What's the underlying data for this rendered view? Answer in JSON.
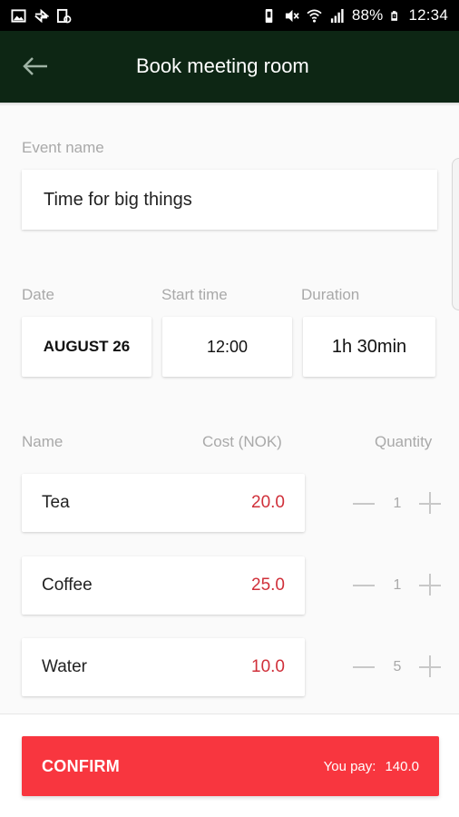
{
  "status_bar": {
    "battery_percent": "88%",
    "time": "12:34",
    "left_icons": [
      "image-icon",
      "sync-icon",
      "device-icon"
    ],
    "right_icons": [
      "vibrate-icon",
      "mute-icon",
      "wifi-icon",
      "signal-icon",
      "battery-icon"
    ]
  },
  "app_bar": {
    "title": "Book meeting room",
    "back_icon": "arrow-left-icon",
    "background": "#0d2614"
  },
  "form": {
    "event_name_label": "Event name",
    "event_name_value": "Time for big things",
    "date_label": "Date",
    "date_value": "AUGUST 26",
    "start_time_label": "Start time",
    "start_time_value": "12:00",
    "duration_label": "Duration",
    "duration_value": "1h 30min"
  },
  "items_header": {
    "name": "Name",
    "cost": "Cost (NOK)",
    "quantity": "Quantity"
  },
  "items": [
    {
      "name": "Tea",
      "cost": "20.0",
      "quantity": "1"
    },
    {
      "name": "Coffee",
      "cost": "25.0",
      "quantity": "1"
    },
    {
      "name": "Water",
      "cost": "10.0",
      "quantity": "5"
    }
  ],
  "footer": {
    "confirm_label": "CONFIRM",
    "pay_label": "You pay:",
    "pay_value": "140.0",
    "accent_color": "#f8363f"
  }
}
